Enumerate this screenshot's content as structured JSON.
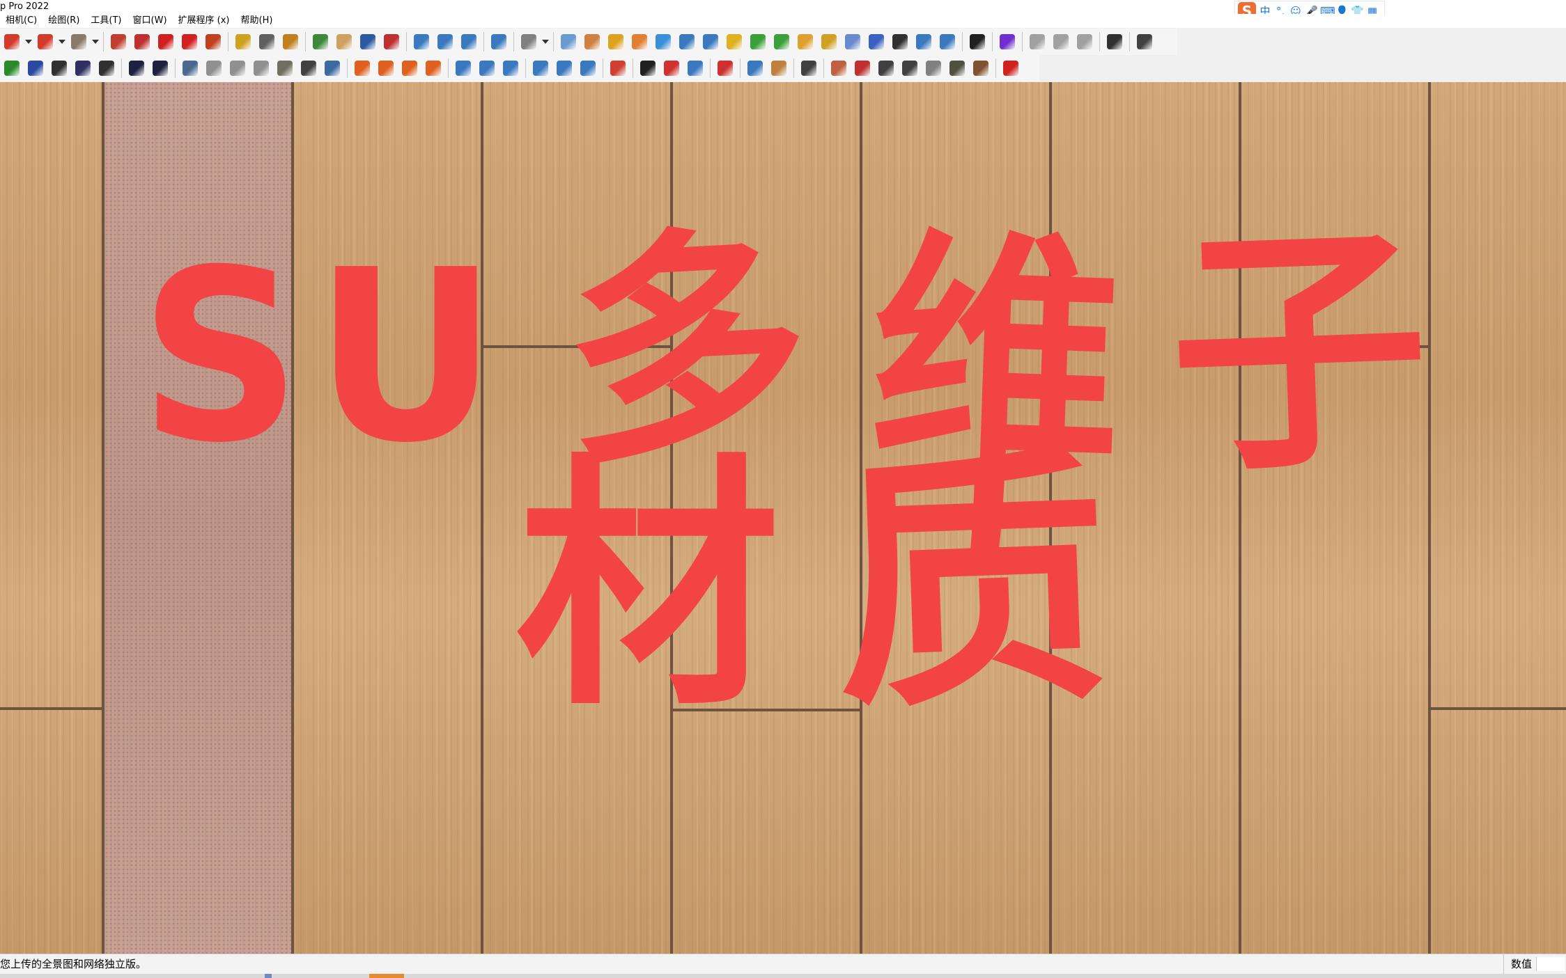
{
  "window": {
    "title": "p Pro 2022"
  },
  "menu": [
    "相机(C)",
    "绘图(R)",
    "工具(T)",
    "窗口(W)",
    "扩展程序 (x)",
    "帮助(H)"
  ],
  "ime": {
    "logo": "S",
    "items": [
      {
        "icon": "chinese-mode-icon",
        "glyph": "中"
      },
      {
        "icon": "punctuation-icon",
        "glyph": "°,"
      },
      {
        "icon": "emoji-icon",
        "glyph": "☺"
      },
      {
        "icon": "microphone-icon",
        "glyph": "🎤"
      },
      {
        "icon": "keyboard-icon",
        "glyph": "⌨"
      },
      {
        "icon": "user-icon",
        "glyph": "👤"
      },
      {
        "icon": "skin-icon",
        "glyph": "👕"
      },
      {
        "icon": "toolbox-icon",
        "glyph": "▦"
      }
    ]
  },
  "toolbar1": [
    {
      "icon": "pencil-line-icon",
      "color": "#d23a2a"
    },
    {
      "dropdown": true
    },
    {
      "icon": "arc-icon",
      "color": "#d23a2a"
    },
    {
      "dropdown": true
    },
    {
      "icon": "rectangle-icon",
      "color": "#8a7a6a"
    },
    {
      "dropdown": true
    },
    {
      "sep": true
    },
    {
      "icon": "push-pull-icon",
      "color": "#c04030"
    },
    {
      "icon": "follow-me-icon",
      "color": "#c03030"
    },
    {
      "icon": "move-icon",
      "color": "#d22020"
    },
    {
      "icon": "rotate-icon",
      "color": "#d22020"
    },
    {
      "icon": "scale-icon",
      "color": "#c04020"
    },
    {
      "sep": true
    },
    {
      "icon": "tape-measure-icon",
      "color": "#d0a020"
    },
    {
      "icon": "text-icon",
      "color": "#606060"
    },
    {
      "icon": "paint-bucket-icon",
      "color": "#c08020"
    },
    {
      "sep": true
    },
    {
      "icon": "orbit-icon",
      "color": "#3a8a3a"
    },
    {
      "icon": "pan-icon",
      "color": "#d0a060"
    },
    {
      "icon": "zoom-icon",
      "color": "#2a5aa0"
    },
    {
      "icon": "zoom-extents-icon",
      "color": "#c03030"
    },
    {
      "sep": true
    },
    {
      "icon": "solar-north-icon",
      "color": "#3a78c0"
    },
    {
      "icon": "sandbox-icon",
      "color": "#3a78c0"
    },
    {
      "icon": "layers-icon",
      "color": "#3a78c0"
    },
    {
      "sep": true
    },
    {
      "icon": "stamp-icon",
      "color": "#3a78c0"
    },
    {
      "sep": true
    },
    {
      "icon": "account-icon",
      "color": "#808080"
    },
    {
      "dropdown": true
    },
    {
      "sep": true
    },
    {
      "icon": "components-icon",
      "color": "#6a9ad0"
    },
    {
      "icon": "settings-sliders-icon",
      "color": "#d08040"
    },
    {
      "icon": "light-bulb-icon",
      "color": "#e0a020"
    },
    {
      "icon": "picture-icon",
      "color": "#e08030"
    },
    {
      "icon": "square-icon",
      "color": "#3a90d8"
    },
    {
      "icon": "axes-icon",
      "color": "#3a78c0"
    },
    {
      "icon": "curve-icon",
      "color": "#3a78c0"
    },
    {
      "icon": "box-icon",
      "color": "#e0b020"
    },
    {
      "icon": "diamond-green-icon",
      "color": "#3aa03a"
    },
    {
      "icon": "diamond-outline-icon",
      "color": "#3aa03a"
    },
    {
      "icon": "hatching-icon",
      "color": "#e0a030"
    },
    {
      "icon": "palette-icon",
      "color": "#d0a020"
    },
    {
      "icon": "link-icon",
      "color": "#6a8ad0"
    },
    {
      "icon": "pen-icon",
      "color": "#3a60c0"
    },
    {
      "icon": "render-icon",
      "color": "#303030"
    },
    {
      "icon": "frame-icon",
      "color": "#3a78c0"
    },
    {
      "icon": "cube-icon",
      "color": "#3a78c0"
    },
    {
      "sep": true
    },
    {
      "icon": "shape-tool-icon",
      "color": "#202020"
    },
    {
      "sep": true
    },
    {
      "icon": "plugin-p-icon",
      "color": "#7030d0"
    },
    {
      "sep": true
    },
    {
      "icon": "camera-icon",
      "color": "#a0a0a0"
    },
    {
      "icon": "scene-icon",
      "color": "#a0a0a0"
    },
    {
      "icon": "photo-icon",
      "color": "#a0a0a0"
    },
    {
      "sep": true
    },
    {
      "icon": "history-icon",
      "color": "#303030"
    },
    {
      "sep": true
    },
    {
      "icon": "extension-icon",
      "color": "#404040"
    }
  ],
  "toolbar2": [
    {
      "icon": "tree-icon",
      "color": "#2a8a2a"
    },
    {
      "icon": "terrain-icon",
      "color": "#2a4aa0"
    },
    {
      "icon": "checker-sphere-icon",
      "color": "#303030"
    },
    {
      "icon": "cloud-upload-icon",
      "color": "#303060"
    },
    {
      "icon": "gear-icon",
      "color": "#303030"
    },
    {
      "sep": true
    },
    {
      "icon": "envelope-icon",
      "color": "#202040"
    },
    {
      "icon": "info-icon",
      "color": "#202040"
    },
    {
      "sep": true
    },
    {
      "icon": "solid-icon",
      "color": "#4a6a90"
    },
    {
      "icon": "hidden-line-icon",
      "color": "#909090"
    },
    {
      "icon": "xray-icon",
      "color": "#909090"
    },
    {
      "icon": "wireframe-icon",
      "color": "#909090"
    },
    {
      "icon": "shaded-icon",
      "color": "#707060"
    },
    {
      "icon": "textured-icon",
      "color": "#404040"
    },
    {
      "icon": "monochrome-icon",
      "color": "#3a6aa0"
    },
    {
      "sep": true
    },
    {
      "icon": "section-plane-icon",
      "color": "#e06020"
    },
    {
      "icon": "section-cut-icon",
      "color": "#e06020"
    },
    {
      "icon": "section-fill-icon",
      "color": "#e06020"
    },
    {
      "icon": "section-gear-icon",
      "color": "#e06020"
    },
    {
      "sep": true
    },
    {
      "icon": "weld-icon",
      "color": "#3a78c0"
    },
    {
      "icon": "offset-curve-icon",
      "color": "#3a78c0"
    },
    {
      "icon": "curve-join-icon",
      "color": "#3a78c0"
    },
    {
      "sep": true
    },
    {
      "icon": "scale-box-icon",
      "color": "#3a78c0"
    },
    {
      "icon": "molecule-icon",
      "color": "#3a78c0"
    },
    {
      "icon": "refresh-icon",
      "color": "#3a78c0"
    },
    {
      "sep": true
    },
    {
      "icon": "browser-icon",
      "color": "#d04030"
    },
    {
      "sep": true
    },
    {
      "icon": "black-white-icon",
      "color": "#202020"
    },
    {
      "icon": "trash-red-icon",
      "color": "#d03030"
    },
    {
      "icon": "trash-blue-icon",
      "color": "#3a78c0"
    },
    {
      "sep": true
    },
    {
      "icon": "swap-icon",
      "color": "#d03030"
    },
    {
      "sep": true
    },
    {
      "icon": "package-icon",
      "color": "#3a78c0"
    },
    {
      "icon": "bandage-icon",
      "color": "#c08040"
    },
    {
      "sep": true
    },
    {
      "icon": "flower-icon",
      "color": "#404040"
    },
    {
      "sep": true
    },
    {
      "icon": "book-icon",
      "color": "#c06040"
    },
    {
      "icon": "map-icon",
      "color": "#c03030"
    },
    {
      "icon": "material-icon",
      "color": "#404040"
    },
    {
      "icon": "material-2-icon",
      "color": "#404040"
    },
    {
      "icon": "roll-icon",
      "color": "#808080"
    },
    {
      "icon": "plane-icon",
      "color": "#505040"
    },
    {
      "icon": "material-3-icon",
      "color": "#805030"
    },
    {
      "sep": true
    },
    {
      "icon": "table-icon",
      "color": "#d02020"
    }
  ],
  "overlay": {
    "line1": [
      "SU",
      "多",
      "维",
      "子"
    ],
    "line2": [
      "材",
      "质"
    ],
    "color": "#f24444"
  },
  "status": {
    "message": "您上传的全景图和网络独立版。",
    "value_label": "数值",
    "value": ""
  }
}
